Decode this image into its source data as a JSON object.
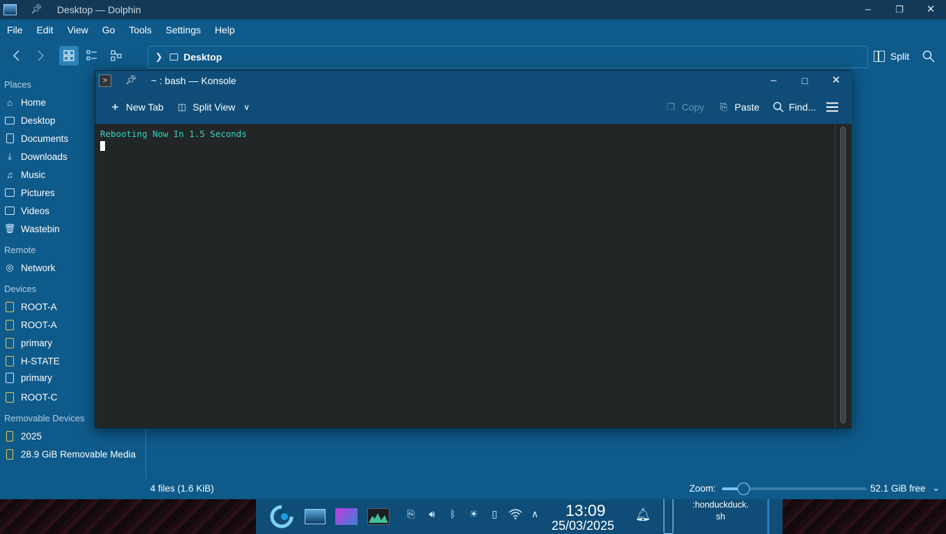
{
  "dolphin": {
    "title": "Desktop — Dolphin",
    "menu": [
      "File",
      "Edit",
      "View",
      "Go",
      "Tools",
      "Settings",
      "Help"
    ],
    "location": "Desktop",
    "split_label": "Split",
    "sidebar": {
      "places_header": "Places",
      "places": [
        {
          "label": "Home",
          "icon": "home-icon"
        },
        {
          "label": "Desktop",
          "icon": "desktop-icon"
        },
        {
          "label": "Documents",
          "icon": "documents-icon"
        },
        {
          "label": "Downloads",
          "icon": "downloads-icon"
        },
        {
          "label": "Music",
          "icon": "music-icon"
        },
        {
          "label": "Pictures",
          "icon": "pictures-icon"
        },
        {
          "label": "Videos",
          "icon": "videos-icon"
        },
        {
          "label": "Wastebin",
          "icon": "wastebin-icon"
        }
      ],
      "remote_header": "Remote",
      "remote": [
        {
          "label": "Network",
          "icon": "network-icon"
        }
      ],
      "devices_header": "Devices",
      "devices": [
        {
          "label": "ROOT-A",
          "icon": "drive-icon"
        },
        {
          "label": "ROOT-A",
          "icon": "drive-icon"
        },
        {
          "label": "primary",
          "icon": "drive-icon"
        },
        {
          "label": "H-STATE",
          "icon": "drive-icon"
        },
        {
          "label": "primary",
          "icon": "drive-icon"
        },
        {
          "label": "ROOT-C",
          "icon": "drive-icon"
        }
      ],
      "removable_header": "Removable Devices",
      "removable": [
        {
          "label": "2025",
          "icon": "usb-drive-icon"
        },
        {
          "label": "28.9 GiB Removable Media",
          "icon": "usb-drive-icon"
        }
      ]
    },
    "status": {
      "files": "4 files (1.6 KiB)",
      "zoom_label": "Zoom:",
      "zoom_level": 0.15,
      "free_space": "52.1 GiB free"
    }
  },
  "konsole": {
    "title": "~ : bash — Konsole",
    "toolbar": {
      "new_tab": "New Tab",
      "split_view": "Split View",
      "copy": "Copy",
      "paste": "Paste",
      "find": "Find..."
    },
    "terminal_lines": [
      "Rebooting Now In 1.5 Seconds"
    ]
  },
  "taskbar": {
    "time": "13:09",
    "date": "25/03/2025",
    "task_label": ":honduckduck.\nsh"
  },
  "colors": {
    "dolphin_bg": "#0e5a8a",
    "titlebar": "#123a58",
    "terminal_bg": "#232627",
    "terminal_text": "#2fd7c8",
    "panel_bg": "#0f4d78"
  }
}
